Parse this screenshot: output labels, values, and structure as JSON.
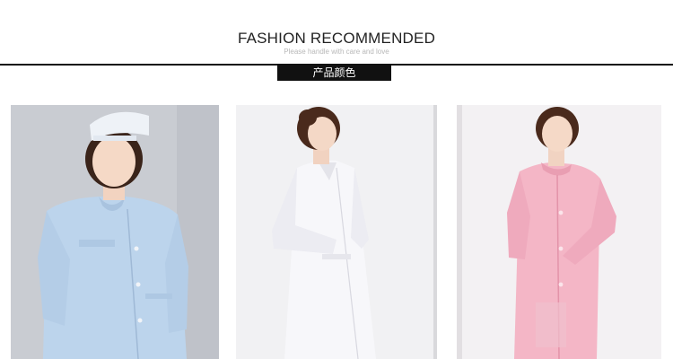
{
  "header": {
    "title": "FASHION RECOMMENDED",
    "subtitle": "Please handle with care and love",
    "tag": "产品颜色"
  },
  "products": [
    {
      "image": "light-blue-nurse-uniform-photo",
      "color": "#bcd4ec"
    },
    {
      "image": "white-lab-coat-photo",
      "color": "#f4f4f8"
    },
    {
      "image": "pink-nurse-uniform-photo",
      "color": "#f4b6c6"
    }
  ]
}
